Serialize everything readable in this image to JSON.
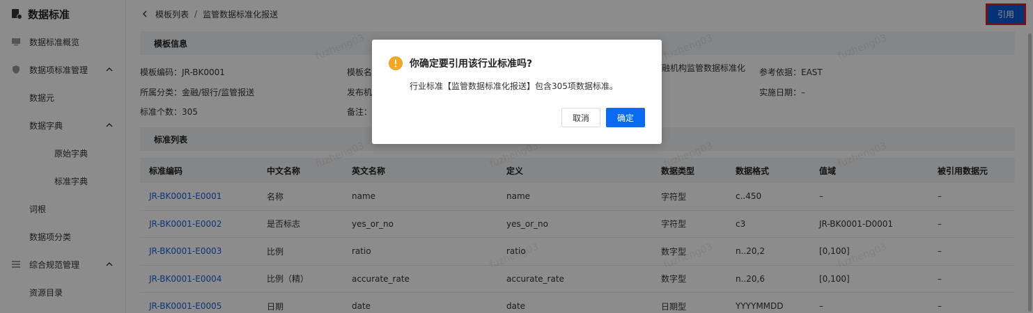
{
  "sidebar": {
    "brand": "数据标准",
    "items": [
      {
        "label": "数据标准概览"
      },
      {
        "label": "数据项标准管理"
      },
      {
        "label": "数据元"
      },
      {
        "label": "数据字典"
      },
      {
        "label": "原始字典"
      },
      {
        "label": "标准字典"
      },
      {
        "label": "词根"
      },
      {
        "label": "数据项分类"
      },
      {
        "label": "综合规范管理"
      },
      {
        "label": "资源目录"
      }
    ]
  },
  "header": {
    "crumb_parent": "模板列表",
    "crumb_sep": "/",
    "crumb_current": "监管数据标准化报送",
    "quote_button": "引用"
  },
  "template_info": {
    "section_title": "模板信息",
    "code": "模板编码：JR-BK0001",
    "name_label": "模板名",
    "org": "融机构监管数据标准化",
    "reference": "参考依据：EAST",
    "category": "所属分类：金融/银行/监管报送",
    "publisher_label": "发布机",
    "impl_date": "实施日期：–",
    "count": "标准个数：305",
    "remark_label": "备注："
  },
  "standards": {
    "section_title": "标准列表",
    "columns": [
      "标准编码",
      "中文名称",
      "英文名称",
      "定义",
      "数据类型",
      "数据格式",
      "值域",
      "被引用数据元"
    ],
    "rows": [
      [
        "JR-BK0001-E0001",
        "名称",
        "name",
        "name",
        "字符型",
        "c..450",
        "–",
        "–"
      ],
      [
        "JR-BK0001-E0002",
        "是否标志",
        "yes_or_no",
        "yes_or_no",
        "字符型",
        "c3",
        "JR-BK0001-D0001",
        "–"
      ],
      [
        "JR-BK0001-E0003",
        "比例",
        "ratio",
        "ratio",
        "数字型",
        "n..20,2",
        "[0,100]",
        "–"
      ],
      [
        "JR-BK0001-E0004",
        "比例（精）",
        "accurate_rate",
        "accurate_rate",
        "数字型",
        "n..20,6",
        "[0,100]",
        "–"
      ],
      [
        "JR-BK0001-E0005",
        "日期",
        "date",
        "date",
        "日期型",
        "YYYYMMDD",
        "–",
        "–"
      ]
    ]
  },
  "watermark_text": "fuzheng03",
  "dialog": {
    "title": "你确定要引用该行业标准吗?",
    "body": "行业标准【监管数据标准化报送】包含305项数据标准。",
    "cancel": "取消",
    "ok": "确定"
  },
  "colors": {
    "accent": "#0a6bf0",
    "link": "#1a5ed8",
    "highlight_border": "#e21b1b",
    "warning": "#f5a623"
  }
}
